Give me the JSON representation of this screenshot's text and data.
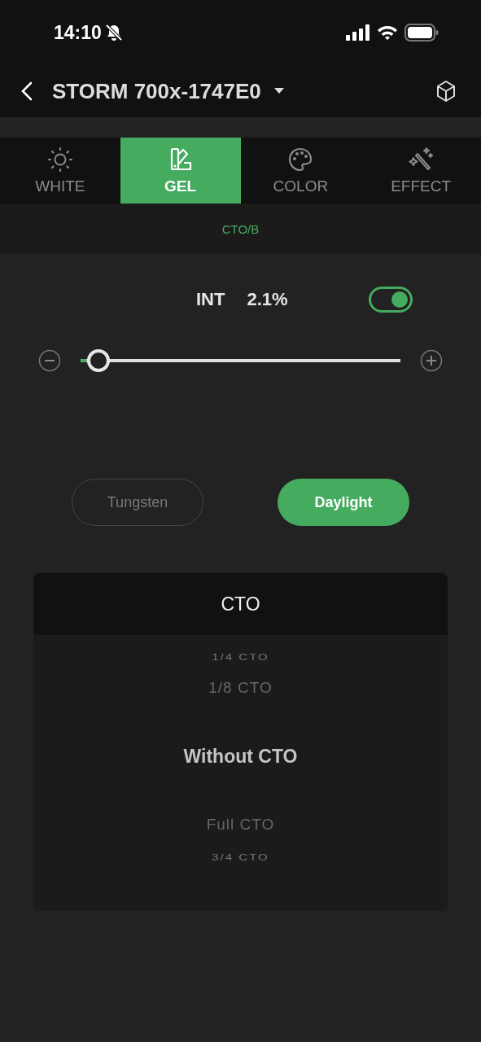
{
  "status_bar": {
    "time": "14:10",
    "silent": true
  },
  "header": {
    "title": "STORM 700x-1747E0"
  },
  "tabs": [
    {
      "label": "WHITE",
      "selected": false
    },
    {
      "label": "GEL",
      "selected": true
    },
    {
      "label": "COLOR",
      "selected": false
    },
    {
      "label": "EFFECT",
      "selected": false
    }
  ],
  "sub_tab": {
    "label": "CTO/B"
  },
  "intensity": {
    "label": "INT",
    "reading": "2.1%",
    "on": true,
    "level": 0.021
  },
  "source_buttons": [
    {
      "label": "Tungsten",
      "selected": false
    },
    {
      "label": "Daylight",
      "selected": true
    }
  ],
  "picker": {
    "title": "CTO",
    "items": [
      {
        "label": "1/4 CTO",
        "selected": false
      },
      {
        "label": "1/8 CTO",
        "selected": false
      },
      {
        "label": "Without CTO",
        "selected": true
      },
      {
        "label": "Full CTO",
        "selected": false
      },
      {
        "label": "3/4 CTO",
        "selected": false
      }
    ]
  }
}
